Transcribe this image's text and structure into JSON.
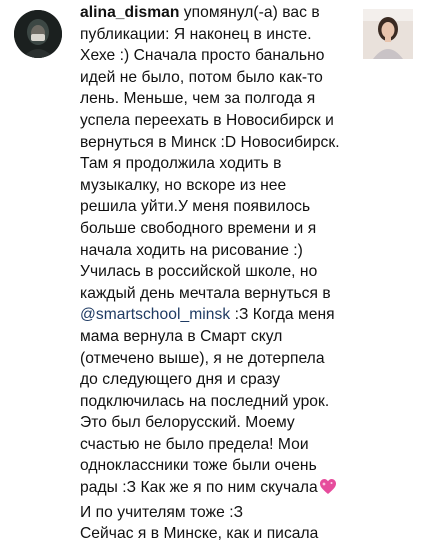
{
  "notification": {
    "username": "alina_disman",
    "lines": [
      " упомянул(-а) вас в",
      "публикации: Я наконец в инсте.",
      "Хехе :) Сначала просто банально",
      "идей не было, потом было как-то",
      "лень. Меньше, чем за полгода я",
      "успела переехать в Новосибирск и",
      "вернуться в Минск :D Новосибирск.",
      "Там я продолжила ходить в",
      "музыкалку, но вскоре из нее",
      "решила уйти.У меня появилось",
      "больше свободного времени и я",
      "начала ходить на рисование :)",
      "Училась в российской школе, но",
      "каждый день мечтала вернуться в",
      "@smartschool_minsk",
      " :З Когда меня",
      "мама вернула в Смарт скул",
      "(отмечено выше), я не дотерпела",
      "до следующего дня и сразу",
      "подключилась на последний урок.",
      "Это был белорусский. Моему",
      "счастью не было предела! Мои",
      "одноклассники тоже были очень",
      "рады :З Как же я по ним скучала",
      "И по учителям тоже :З",
      " Сейчас я в Минске, как и писала"
    ],
    "heart_icon": "sparkling-heart-emoji",
    "colors": {
      "text": "#111111",
      "mention": "#1f3b63",
      "heart": "#e64c9c"
    }
  }
}
